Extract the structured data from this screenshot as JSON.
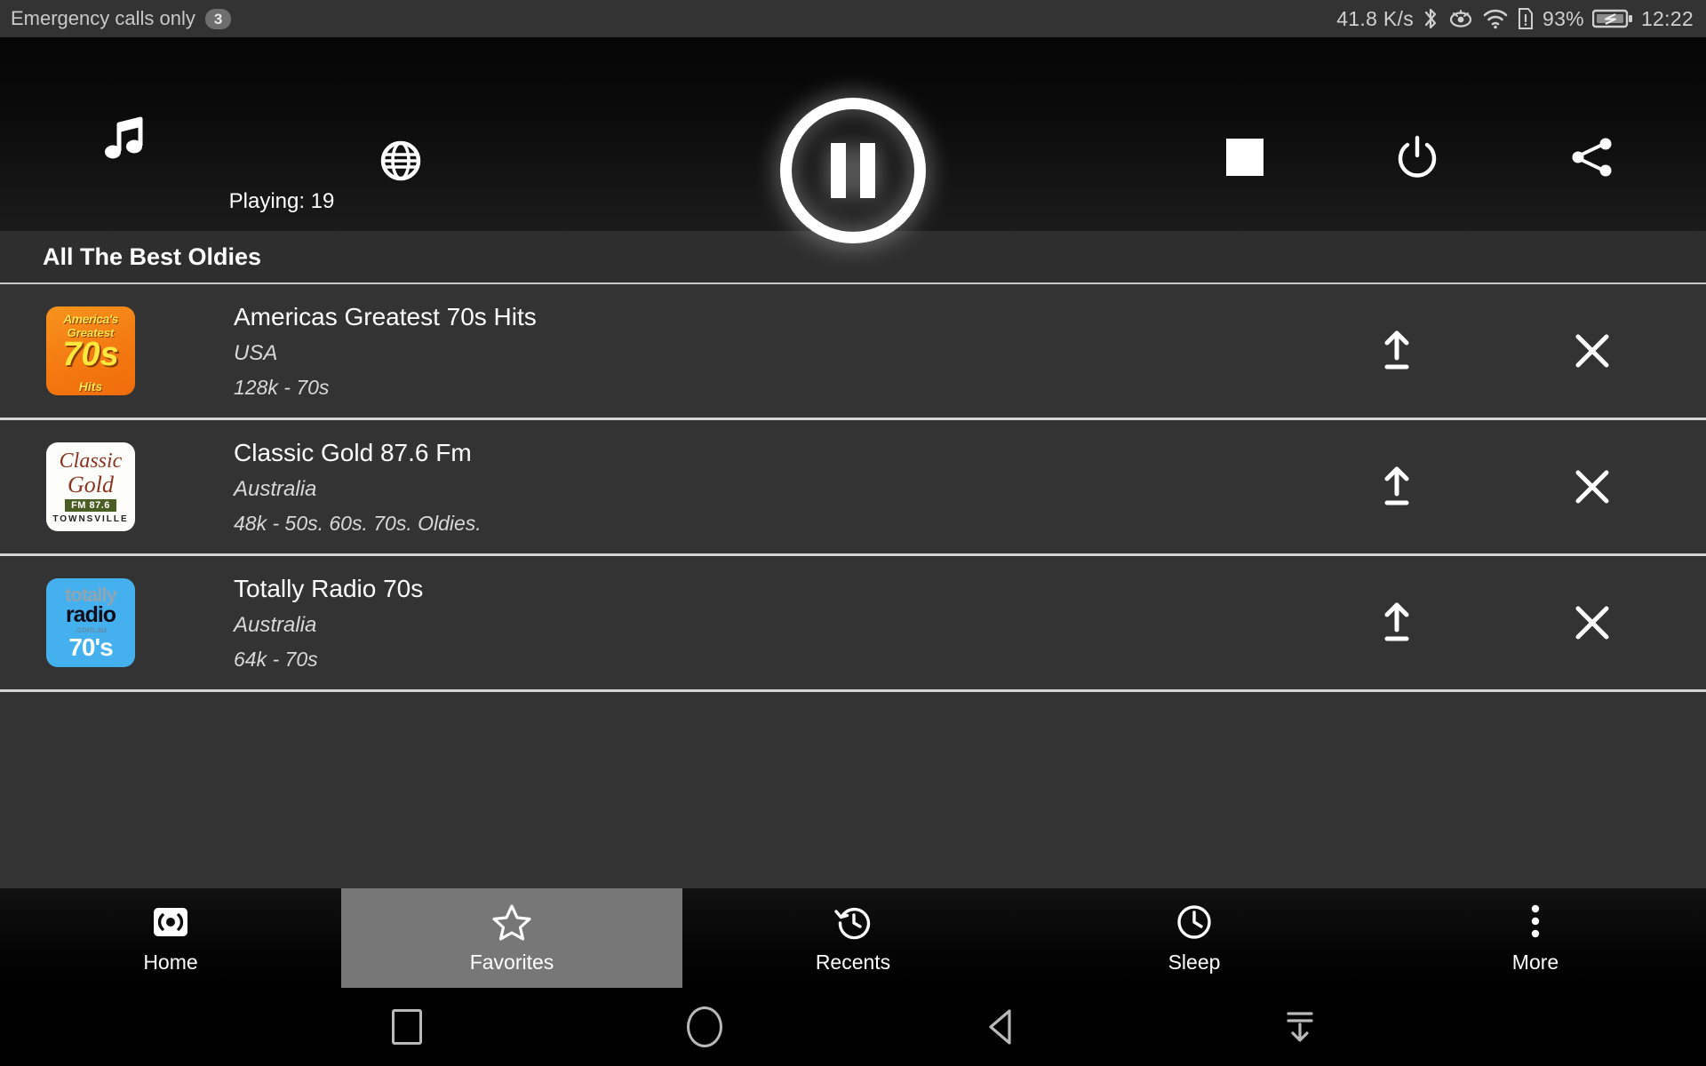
{
  "statusbar": {
    "carrier": "Emergency calls only",
    "notification_count": "3",
    "network_speed": "41.8 K/s",
    "battery_percent": "93%",
    "clock": "12:22",
    "icons": [
      "bluetooth-icon",
      "eye-icon",
      "wifi-icon",
      "sim-alert-icon",
      "battery-charging-icon"
    ]
  },
  "player": {
    "music_icon": "music-note-icon",
    "globe_icon": "globe-icon",
    "playing_label": "Playing: 19",
    "pause_icon": "pause-icon",
    "stop_icon": "stop-icon",
    "power_icon": "power-icon",
    "share_icon": "share-icon"
  },
  "section": {
    "title": "All The Best Oldies"
  },
  "stations": [
    {
      "name": "Americas Greatest 70s Hits",
      "country": "USA",
      "meta": "128k - 70s",
      "logo": {
        "style": "america-70s",
        "line1": "America's",
        "line2": "Greatest",
        "line3": "70s",
        "line4": "Hits"
      },
      "upload_icon": "upload-icon",
      "remove_icon": "close-icon"
    },
    {
      "name": "Classic Gold 87.6 Fm",
      "country": "Australia",
      "meta": "48k - 50s. 60s. 70s. Oldies.",
      "logo": {
        "style": "classic-gold",
        "line1": "Classic",
        "line2": "Gold",
        "line3": "FM 87.6",
        "line4": "TOWNSVILLE"
      },
      "upload_icon": "upload-icon",
      "remove_icon": "close-icon"
    },
    {
      "name": "Totally Radio 70s",
      "country": "Australia",
      "meta": "64k - 70s",
      "logo": {
        "style": "totally-radio",
        "line1": "totally",
        "line2": "radio",
        "line3": ".com.au",
        "line4": "70's"
      },
      "upload_icon": "upload-icon",
      "remove_icon": "close-icon"
    }
  ],
  "tabs": [
    {
      "label": "Home",
      "icon": "broadcast-icon",
      "active": false
    },
    {
      "label": "Favorites",
      "icon": "star-icon",
      "active": true
    },
    {
      "label": "Recents",
      "icon": "history-icon",
      "active": false
    },
    {
      "label": "Sleep",
      "icon": "clock-icon",
      "active": false
    },
    {
      "label": "More",
      "icon": "overflow-dots-icon",
      "active": false
    }
  ],
  "android_nav": {
    "recents_icon": "square-icon",
    "home_icon": "circle-icon",
    "back_icon": "triangle-back-icon",
    "hide_icon": "hide-keyboard-icon"
  },
  "colors": {
    "status_bg": "#333333",
    "list_bg": "#333333",
    "divider": "#d4d4d4",
    "active_tab": "#777777",
    "logo_orange": "#f47a11",
    "logo_blue": "#45b0ee"
  }
}
